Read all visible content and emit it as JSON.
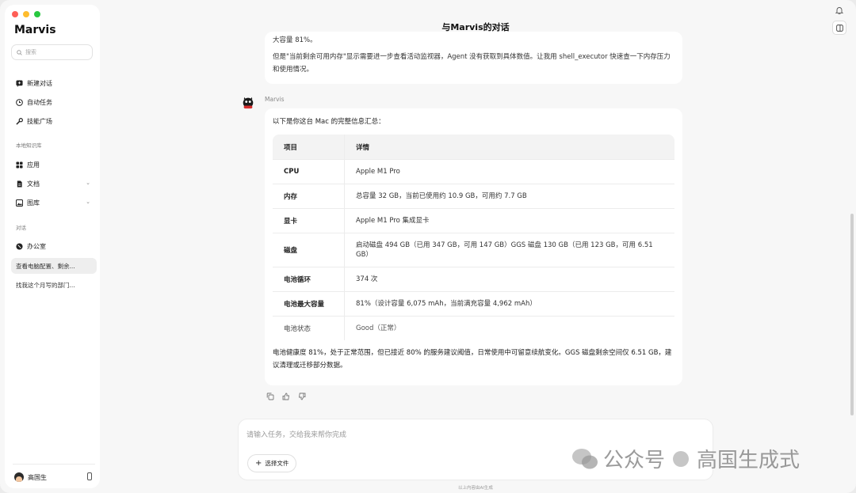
{
  "app": {
    "name": "Marvis",
    "conversation_title": "与Marvis的对话"
  },
  "sidebar": {
    "search_placeholder": "搜索",
    "primary": [
      {
        "label": "新建对话",
        "icon": "new-chat-icon"
      },
      {
        "label": "自动任务",
        "icon": "clock-icon"
      },
      {
        "label": "技能广场",
        "icon": "wrench-icon"
      }
    ],
    "knowledge_label": "本地知识库",
    "knowledge": [
      {
        "label": "应用",
        "icon": "apps-grid-icon"
      },
      {
        "label": "文档",
        "icon": "document-icon"
      },
      {
        "label": "图库",
        "icon": "image-icon"
      }
    ],
    "conversations_label": "对话",
    "conversations": [
      {
        "label": "办公室",
        "icon": "office-icon"
      },
      {
        "label": "查看电脑配置、剩余..."
      },
      {
        "label": "找我这个月写的部门..."
      }
    ],
    "user_name": "高国生"
  },
  "messages": {
    "previous_cut_text": "大容量 81%。",
    "previous_text": "但是\"当前剩余可用内存\"显示需要进一步查看活动监视器，Agent 没有获取到具体数值。让我用 shell_executor 快速查一下内存压力和使用情况。",
    "sender": "Marvis",
    "intro": "以下是你这台 Mac 的完整信息汇总：",
    "table": {
      "headers": [
        "项目",
        "详情"
      ],
      "rows": [
        {
          "key": "CPU",
          "value": "Apple M1 Pro"
        },
        {
          "key": "内存",
          "value": "总容量 32 GB，当前已使用约 10.9 GB，可用约 7.7 GB"
        },
        {
          "key": "显卡",
          "value": "Apple M1 Pro 集成显卡"
        },
        {
          "key": "磁盘",
          "value": "启动磁盘 494 GB（已用 347 GB，可用 147 GB）GGS 磁盘 130 GB（已用 123 GB，可用 6.51 GB）"
        },
        {
          "key": "电池循环",
          "value": "374 次"
        },
        {
          "key": "电池最大容量",
          "value": "81%（设计容量 6,075 mAh，当前满充容量 4,962 mAh）"
        },
        {
          "key": "电池状态",
          "value": "Good（正常）"
        }
      ]
    },
    "outro": "电池健康度 81%，处于正常范围，但已接近 80% 的服务建议阈值，日常使用中可留意续航变化。GGS 磁盘剩余空间仅 6.51 GB，建议清理或迁移部分数据。"
  },
  "composer": {
    "placeholder": "请输入任务，交给我来帮你完成",
    "file_button": "选择文件",
    "footer_note": "以上内容由AI生成"
  },
  "watermark": {
    "left": "公众号",
    "right": "高国生成式"
  },
  "colors": {
    "traffic_red": "#fe5f57",
    "traffic_yellow": "#febc2e",
    "traffic_green": "#28c840"
  }
}
